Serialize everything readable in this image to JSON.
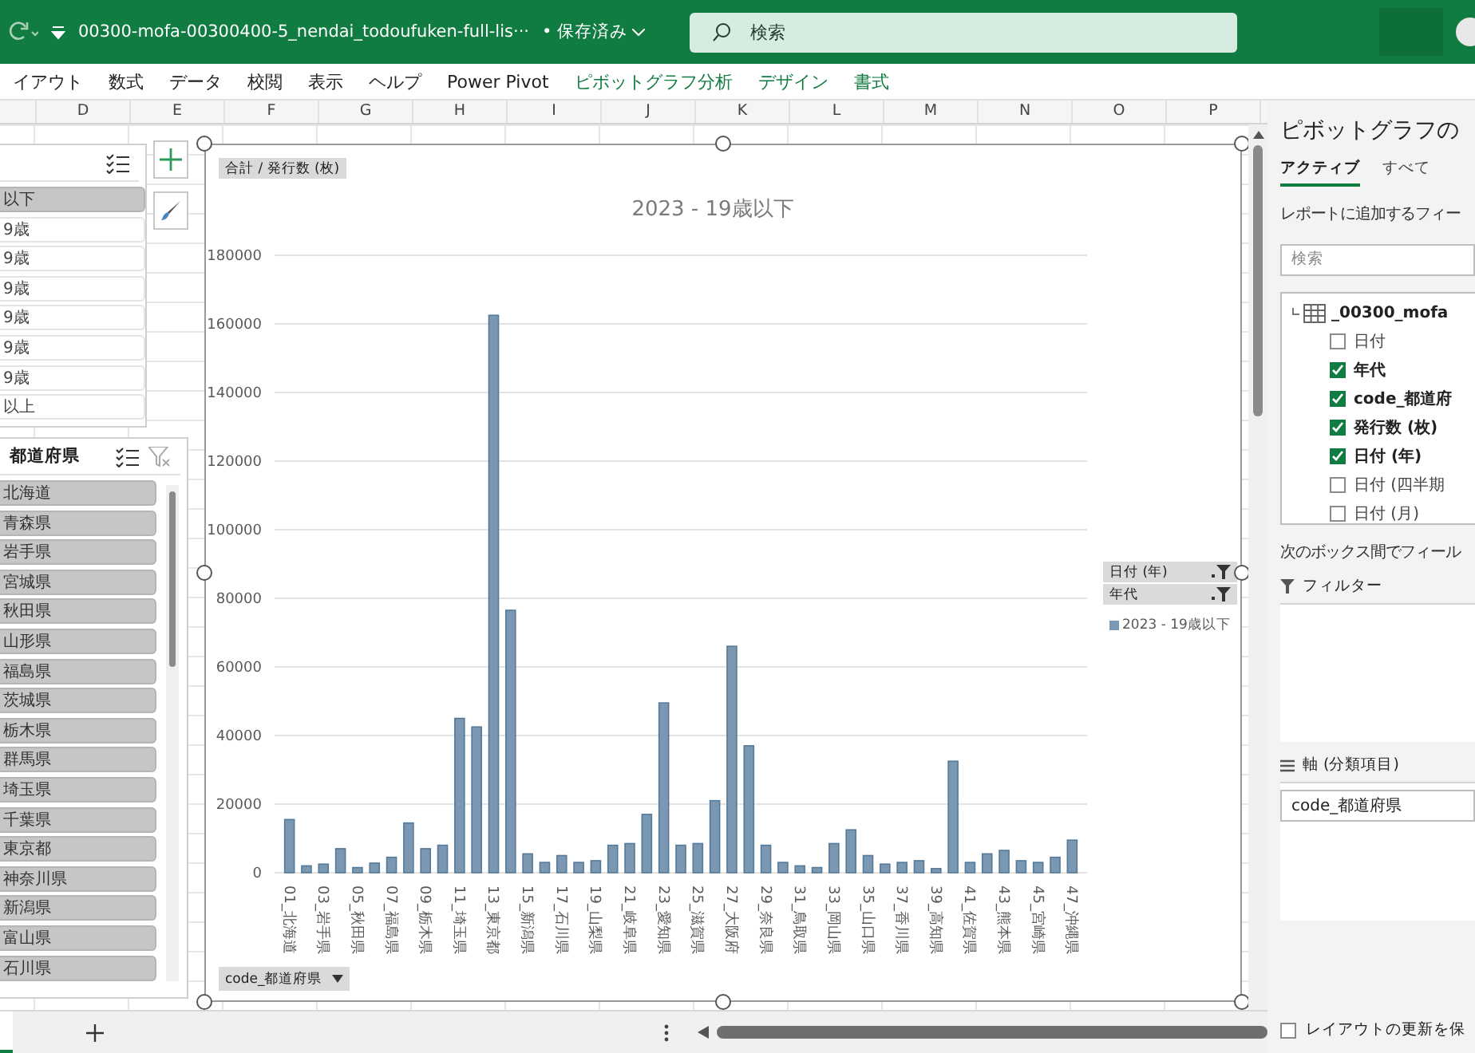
{
  "title_bar": {
    "file_name": "00300-mofa-00300400-5_nendai_todoufuken-full-lis···",
    "save_status": "• 保存済み",
    "search": {
      "placeholder": "検索"
    }
  },
  "ribbon_tabs": [
    {
      "label": "イアウト",
      "contextual": false
    },
    {
      "label": "数式",
      "contextual": false
    },
    {
      "label": "データ",
      "contextual": false
    },
    {
      "label": "校閲",
      "contextual": false
    },
    {
      "label": "表示",
      "contextual": false
    },
    {
      "label": "ヘルプ",
      "contextual": false
    },
    {
      "label": "Power Pivot",
      "contextual": false
    },
    {
      "label": "ピボットグラフ分析",
      "contextual": true
    },
    {
      "label": "デザイン",
      "contextual": true
    },
    {
      "label": "書式",
      "contextual": true
    }
  ],
  "columns": [
    "D",
    "E",
    "F",
    "G",
    "H",
    "I",
    "J",
    "K",
    "L",
    "M",
    "N",
    "O",
    "P"
  ],
  "slicers": [
    {
      "items": [
        {
          "label": "以下",
          "selected": true
        },
        {
          "label": "9歳",
          "selected": false
        },
        {
          "label": "9歳",
          "selected": false
        },
        {
          "label": "9歳",
          "selected": false
        },
        {
          "label": "9歳",
          "selected": false
        },
        {
          "label": "9歳",
          "selected": false
        },
        {
          "label": "9歳",
          "selected": false
        },
        {
          "label": "以上",
          "selected": false
        }
      ]
    },
    {
      "title": "都道府県",
      "items": [
        {
          "label": "北海道",
          "selected": true
        },
        {
          "label": "青森県",
          "selected": true
        },
        {
          "label": "岩手県",
          "selected": true
        },
        {
          "label": "宮城県",
          "selected": true
        },
        {
          "label": "秋田県",
          "selected": true
        },
        {
          "label": "山形県",
          "selected": true
        },
        {
          "label": "福島県",
          "selected": true
        },
        {
          "label": "茨城県",
          "selected": true
        },
        {
          "label": "栃木県",
          "selected": true
        },
        {
          "label": "群馬県",
          "selected": true
        },
        {
          "label": "埼玉県",
          "selected": true
        },
        {
          "label": "千葉県",
          "selected": true
        },
        {
          "label": "東京都",
          "selected": true
        },
        {
          "label": "神奈川県",
          "selected": true
        },
        {
          "label": "新潟県",
          "selected": true
        },
        {
          "label": "富山県",
          "selected": true
        },
        {
          "label": "石川県",
          "selected": true
        }
      ]
    }
  ],
  "chart": {
    "value_field_button": "合計 / 発行数 (枚)",
    "axis_field_button": "code_都道府県",
    "legend_field_buttons": [
      "日付 (年)",
      "年代"
    ],
    "chart_data": {
      "type": "bar",
      "title": "2023 - 19歳以下",
      "grid": true,
      "categories": [
        "01_北海道",
        null,
        "03_岩手県",
        null,
        "05_秋田県",
        null,
        "07_福島県",
        null,
        "09_栃木県",
        null,
        "11_埼玉県",
        null,
        "13_東京都",
        null,
        "15_新潟県",
        null,
        "17_石川県",
        null,
        "19_山梨県",
        null,
        "21_岐阜県",
        null,
        "23_愛知県",
        null,
        "25_滋賀県",
        null,
        "27_大阪府",
        null,
        "29_奈良県",
        null,
        "31_鳥取県",
        null,
        "33_岡山県",
        null,
        "35_山口県",
        null,
        "37_香川県",
        null,
        "39_高知県",
        null,
        "41_佐賀県",
        null,
        "43_熊本県",
        null,
        "45_宮崎県",
        null,
        "47_沖縄県"
      ],
      "series": [
        {
          "name": "2023 - 19歳以下",
          "color": "#7a98b2",
          "values": [
            15500,
            2000,
            2500,
            7000,
            1500,
            2800,
            4500,
            14500,
            7000,
            8000,
            45000,
            42500,
            162500,
            76500,
            5500,
            3000,
            5000,
            3000,
            3500,
            8000,
            8500,
            17000,
            49500,
            8000,
            8500,
            21000,
            66000,
            37000,
            8000,
            3000,
            2000,
            1500,
            8500,
            12500,
            5000,
            2500,
            3000,
            3500,
            1200,
            32500,
            3000,
            5500,
            6500,
            3500,
            3000,
            4500,
            9500
          ]
        }
      ],
      "ylim": [
        0,
        180000
      ],
      "yticks": [
        0,
        20000,
        40000,
        60000,
        80000,
        100000,
        120000,
        140000,
        160000,
        180000
      ]
    }
  },
  "field_pane": {
    "title": "ピボットグラフの",
    "tabs": [
      {
        "label": "アクティブ",
        "selected": true
      },
      {
        "label": "すべて",
        "selected": false
      }
    ],
    "instruction": "レポートに追加するフィー",
    "search": {
      "placeholder": "検索"
    },
    "field_tree": {
      "label": "_00300_mofa",
      "children": [
        {
          "label": "日付",
          "checked": false
        },
        {
          "label": "年代",
          "checked": true
        },
        {
          "label": "code_都道府",
          "checked": true
        },
        {
          "label": "発行数 (枚)",
          "checked": true
        },
        {
          "label": "日付 (年)",
          "checked": true
        },
        {
          "label": "日付 (四半期",
          "checked": false
        },
        {
          "label": "日付 (月)",
          "checked": false
        }
      ]
    },
    "areas_instruction": "次のボックス間でフィール",
    "areas": [
      {
        "kind": "filter",
        "title": "フィルター"
      },
      {
        "kind": "axis",
        "title": "軸 (分類項目)",
        "items": [
          "code_都道府県"
        ]
      }
    ],
    "defer_update": {
      "label": "レイアウトの更新を保",
      "checked": false
    }
  }
}
